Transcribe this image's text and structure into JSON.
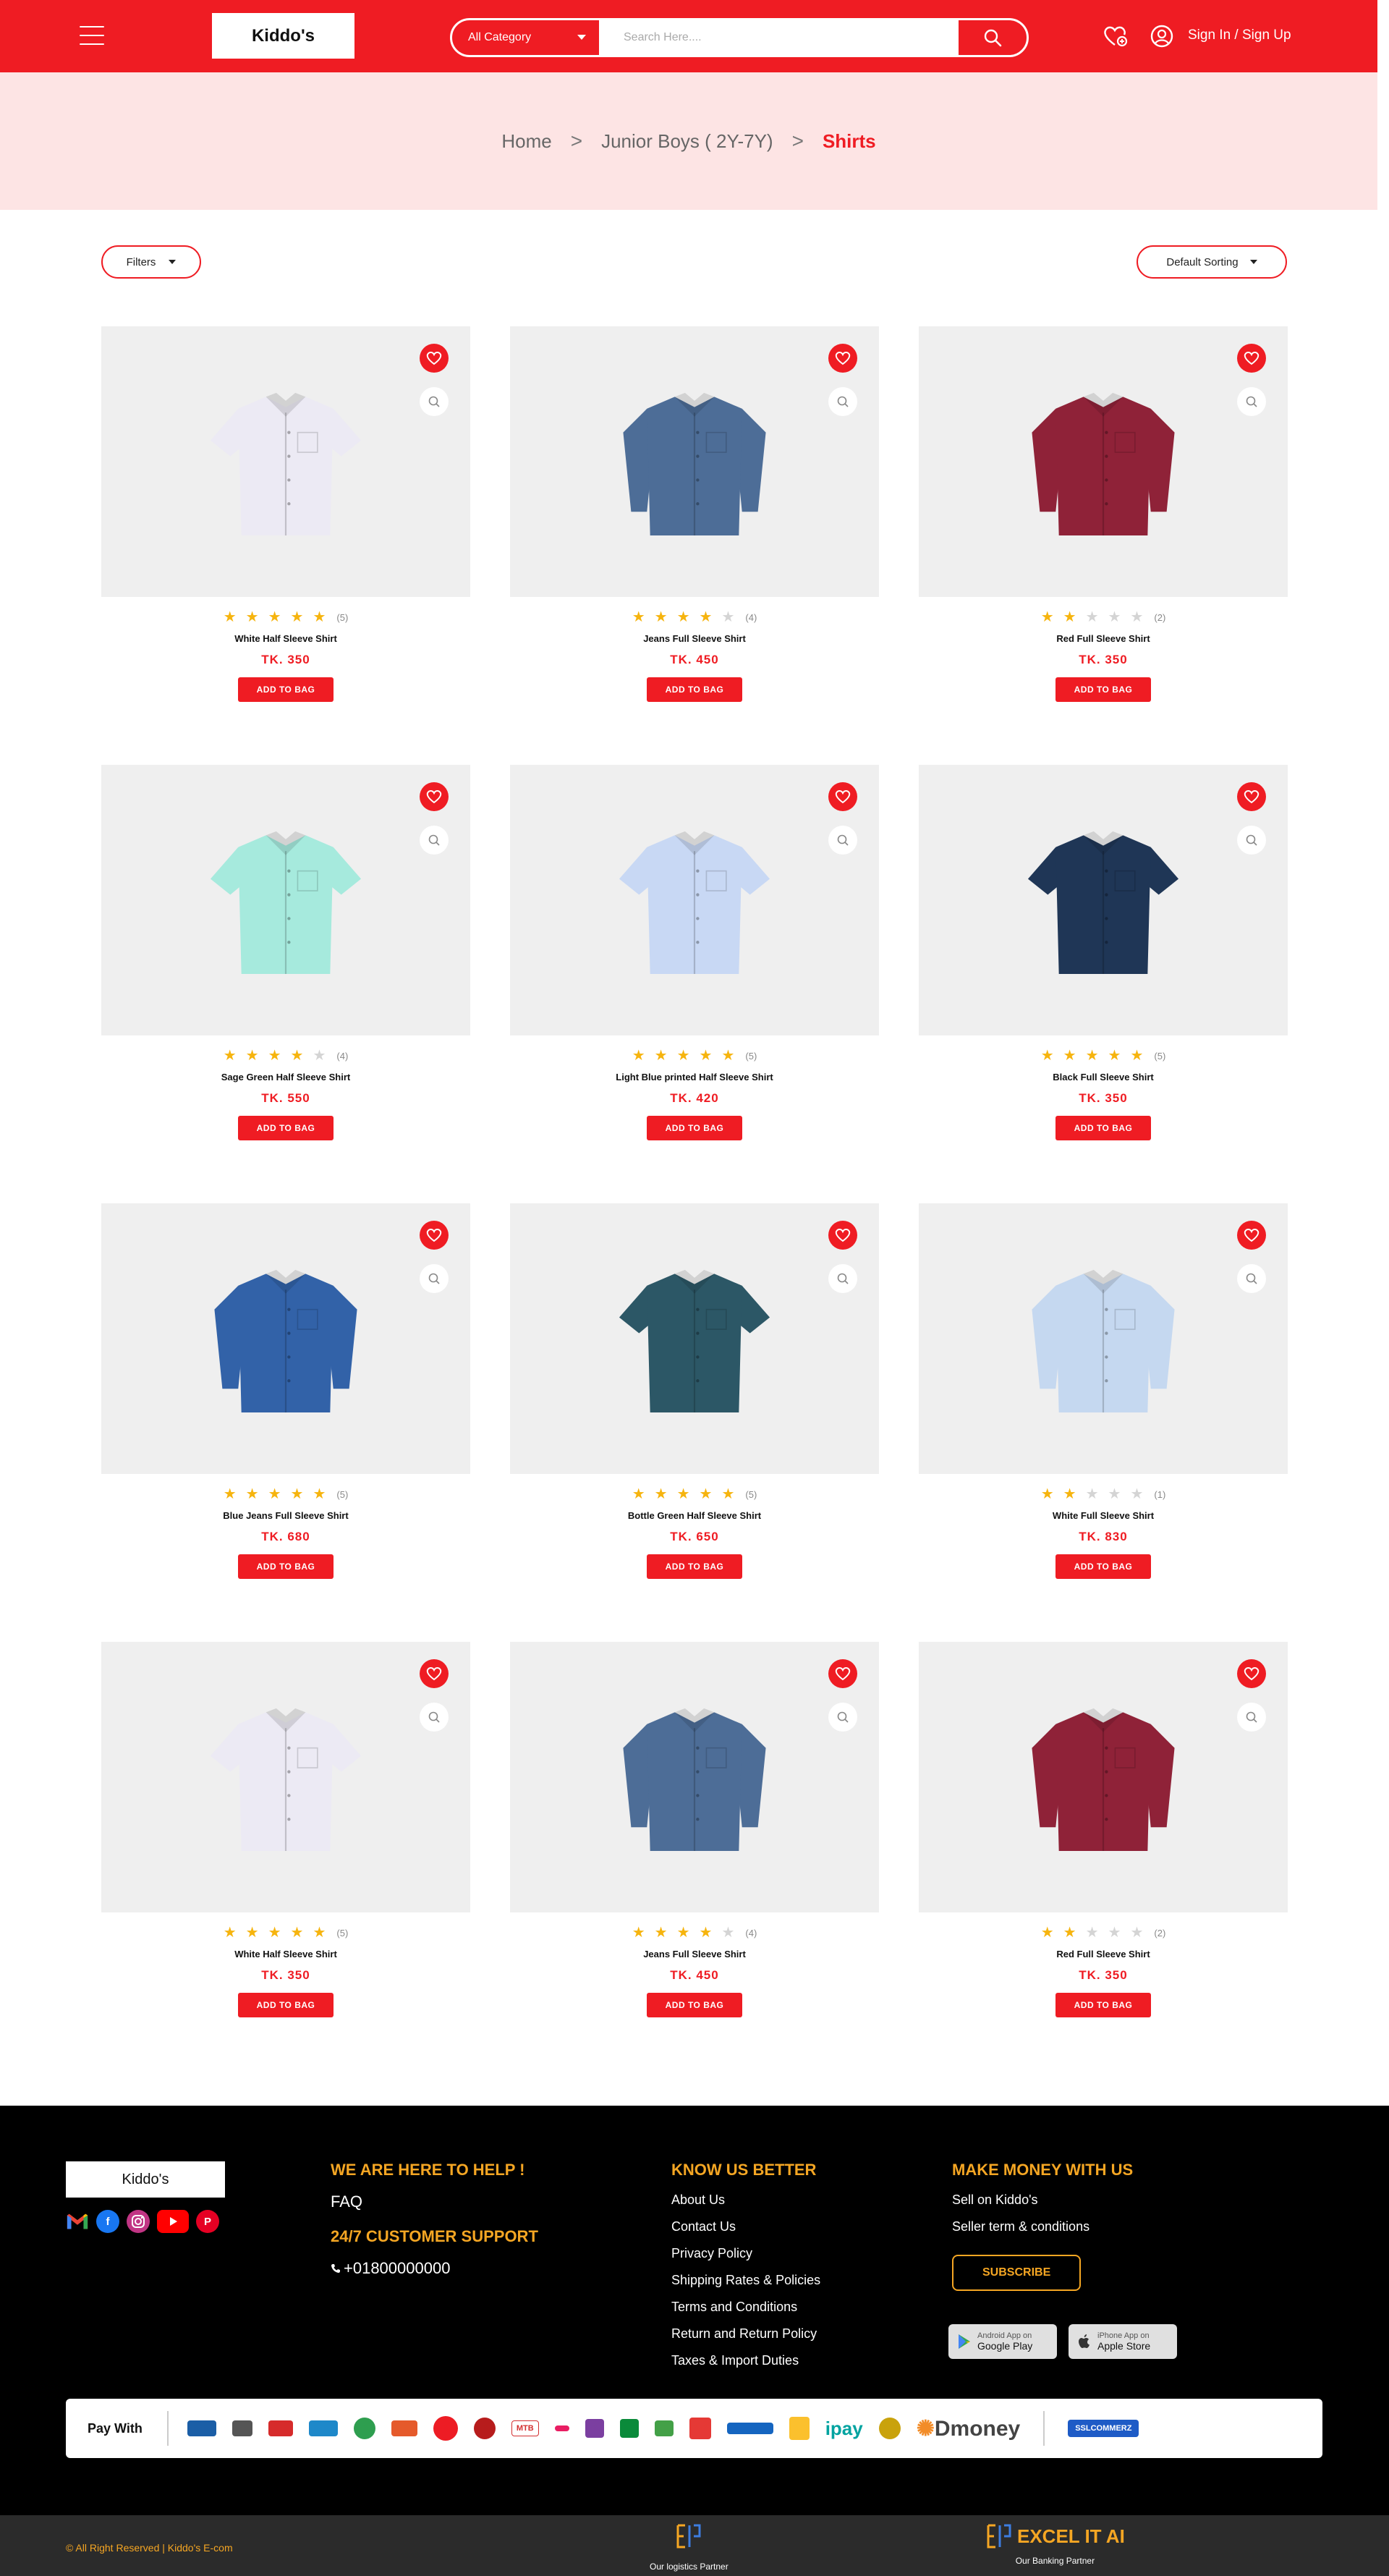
{
  "header": {
    "logo": "Kiddo's",
    "category_label": "All Category",
    "search_placeholder": "Search Here....",
    "signin_label": "Sign In / Sign Up"
  },
  "breadcrumb": {
    "items": [
      "Home",
      "Junior Boys ( 2Y-7Y)",
      "Shirts"
    ],
    "separator": ">"
  },
  "toolbar": {
    "filters_label": "Filters",
    "sort_label": "Default Sorting"
  },
  "products": [
    {
      "name": "White Half Sleeve Shirt",
      "price": "TK. 350",
      "rating": 5,
      "reviews": "(5)",
      "button": "ADD TO BAG",
      "shirt_color": "#eceaf4",
      "sleeve": "half"
    },
    {
      "name": "Jeans Full Sleeve Shirt",
      "price": "TK. 450",
      "rating": 4,
      "reviews": "(4)",
      "button": "ADD TO BAG",
      "shirt_color": "#4d6d97",
      "sleeve": "full"
    },
    {
      "name": "Red Full Sleeve Shirt",
      "price": "TK. 350",
      "rating": 2,
      "reviews": "(2)",
      "button": "ADD TO BAG",
      "shirt_color": "#8f2238",
      "sleeve": "full"
    },
    {
      "name": "Sage Green Half Sleeve  Shirt",
      "price": "TK. 550",
      "rating": 4,
      "reviews": "(4)",
      "button": "ADD TO BAG",
      "shirt_color": "#a6eadd",
      "sleeve": "half"
    },
    {
      "name": "Light Blue printed Half Sleeve Shirt",
      "price": "TK. 420",
      "rating": 5,
      "reviews": "(5)",
      "button": "ADD TO BAG",
      "shirt_color": "#c8d8f4",
      "sleeve": "half"
    },
    {
      "name": "Black Full Sleeve Shirt",
      "price": "TK. 350",
      "rating": 5,
      "reviews": "(5)",
      "button": "ADD TO BAG",
      "shirt_color": "#1f3656",
      "sleeve": "half"
    },
    {
      "name": "Blue Jeans Full Sleeve Shirt",
      "price": "TK. 680",
      "rating": 5,
      "reviews": "(5)",
      "button": "ADD TO BAG",
      "shirt_color": "#3262a8",
      "sleeve": "full"
    },
    {
      "name": "Bottle Green Half Sleeve Shirt",
      "price": "TK. 650",
      "rating": 5,
      "reviews": "(5)",
      "button": "ADD TO BAG",
      "shirt_color": "#2c5766",
      "sleeve": "half"
    },
    {
      "name": "White Full Sleeve Shirt",
      "price": "TK. 830",
      "rating": 2,
      "reviews": "(1)",
      "button": "ADD TO BAG",
      "shirt_color": "#c5d8f0",
      "sleeve": "full"
    },
    {
      "name": "White Half Sleeve Shirt",
      "price": "TK. 350",
      "rating": 5,
      "reviews": "(5)",
      "button": "ADD TO BAG",
      "shirt_color": "#eceaf4",
      "sleeve": "half"
    },
    {
      "name": "Jeans Full Sleeve Shirt",
      "price": "TK. 450",
      "rating": 4,
      "reviews": "(4)",
      "button": "ADD TO BAG",
      "shirt_color": "#4d6d97",
      "sleeve": "full"
    },
    {
      "name": "Red Full Sleeve Shirt",
      "price": "TK. 350",
      "rating": 2,
      "reviews": "(2)",
      "button": "ADD TO BAG",
      "shirt_color": "#8f2238",
      "sleeve": "full"
    }
  ],
  "footer": {
    "logo": "Kiddo's",
    "help_heading": "WE ARE HERE TO HELP !",
    "faq": "FAQ",
    "support_heading": "24/7 CUSTOMER SUPPORT",
    "phone": "+01800000000",
    "know_heading": "KNOW US BETTER",
    "know_links": [
      "About Us",
      "Contact Us",
      "Privacy Policy",
      "Shipping Rates & Policies",
      "Terms and Conditions",
      "Return and Return Policy",
      "Taxes & Import Duties"
    ],
    "money_heading": "MAKE MONEY WITH US",
    "money_links": [
      "Sell on Kiddo's",
      "Seller term & conditions"
    ],
    "subscribe_label": "SUBSCRIBE",
    "android_small": "Android App on",
    "android_big": "Google Play",
    "ios_small": "iPhone App on",
    "ios_big": "Apple Store",
    "pay_title": "Pay With",
    "pay_logos": [
      "MTB",
      "ipay",
      "Dmoney",
      "SSLCOMMERZ"
    ],
    "copyright": "© All Right Reserved | Kiddo's E-com",
    "logistics_label": "Our logistics Partner",
    "banking_label": "Our Banking Partner",
    "banking_logo": "EXCEL IT AI"
  },
  "colors": {
    "brand_red": "#ef1c23",
    "breadcrumb_bg": "#fde4e4",
    "star_on": "#f6b40e",
    "footer_accent": "#f5a623"
  }
}
